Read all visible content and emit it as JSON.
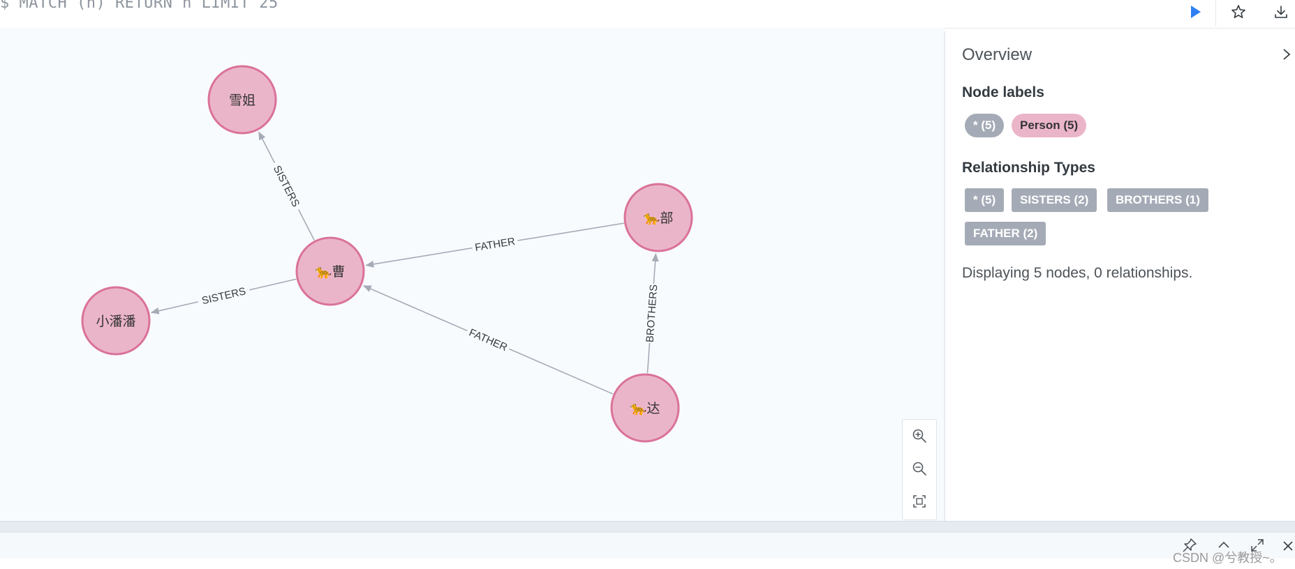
{
  "query": {
    "text": "$ MATCH (n) RETURN n LIMIT 25"
  },
  "toolbar": {
    "run_icon": "play-icon",
    "favorite_icon": "star-icon",
    "download_icon": "download-icon"
  },
  "graph": {
    "nodes": [
      {
        "id": "xuejie",
        "label": "雪姐",
        "emoji": ""
      },
      {
        "id": "cao",
        "label": "曹",
        "emoji": "🐆"
      },
      {
        "id": "xiaopanpan",
        "label": "小潘潘",
        "emoji": ""
      },
      {
        "id": "bu",
        "label": "部",
        "emoji": "🐆"
      },
      {
        "id": "da",
        "label": "达",
        "emoji": "🐆"
      }
    ],
    "relationships": [
      {
        "from": "cao",
        "to": "xuejie",
        "type": "SISTERS"
      },
      {
        "from": "cao",
        "to": "xiaopanpan",
        "type": "SISTERS"
      },
      {
        "from": "bu",
        "to": "cao",
        "type": "FATHER"
      },
      {
        "from": "da",
        "to": "cao",
        "type": "FATHER"
      },
      {
        "from": "da",
        "to": "bu",
        "type": "BROTHERS"
      }
    ],
    "node_fill": "#ebb5c9",
    "node_stroke": "#da7298",
    "edge_color": "#a5abb6"
  },
  "zoom": {
    "zoom_in_icon": "zoom-in-icon",
    "zoom_out_icon": "zoom-out-icon",
    "fit_icon": "fit-to-screen-icon"
  },
  "overview": {
    "title": "Overview",
    "node_labels_title": "Node labels",
    "node_labels": [
      {
        "label": "* (5)",
        "kind": "all"
      },
      {
        "label": "Person (5)",
        "kind": "person"
      }
    ],
    "rel_types_title": "Relationship Types",
    "rel_types": [
      "* (5)",
      "SISTERS (2)",
      "BROTHERS (1)",
      "FATHER (2)"
    ],
    "summary": "Displaying 5 nodes, 0 relationships."
  },
  "watermark": "CSDN @兮教授~。",
  "colors": {
    "accent": "#2f7ff2",
    "chip_gray": "#a5abb6",
    "chip_person": "#ebb5c9"
  }
}
